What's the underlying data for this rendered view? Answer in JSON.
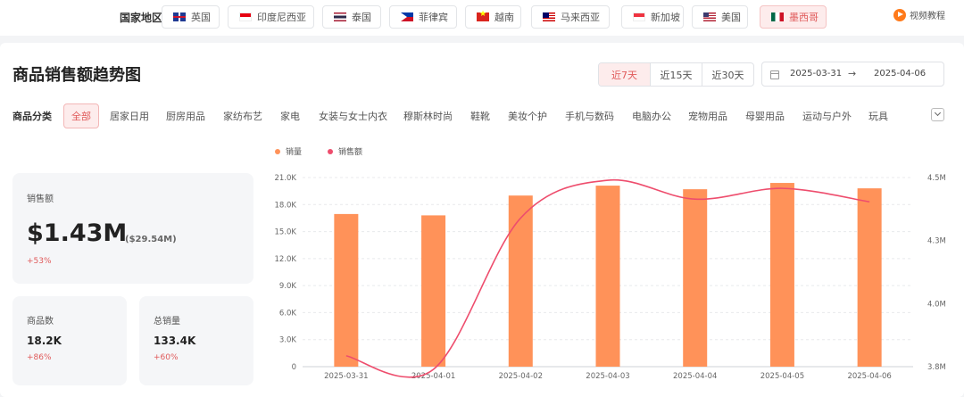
{
  "region": {
    "label": "国家地区",
    "countries": [
      {
        "name": "英国",
        "flag": "uk-flag-icon",
        "active": false
      },
      {
        "name": "印度尼西亚",
        "flag": "indonesia-flag-icon",
        "active": false
      },
      {
        "name": "泰国",
        "flag": "thailand-flag-icon",
        "active": false
      },
      {
        "name": "菲律宾",
        "flag": "philippines-flag-icon",
        "active": false
      },
      {
        "name": "越南",
        "flag": "vietnam-flag-icon",
        "active": false
      },
      {
        "name": "马来西亚",
        "flag": "malaysia-flag-icon",
        "active": false
      },
      {
        "name": "新加坡",
        "flag": "singapore-flag-icon",
        "active": false
      },
      {
        "name": "美国",
        "flag": "usa-flag-icon",
        "active": false
      },
      {
        "name": "墨西哥",
        "flag": "mexico-flag-icon",
        "active": true
      }
    ],
    "video_link": "视频教程"
  },
  "header": {
    "title": "商品销售额趋势图",
    "ranges": [
      {
        "label": "近7天",
        "active": true
      },
      {
        "label": "近15天",
        "active": false
      },
      {
        "label": "近30天",
        "active": false
      }
    ],
    "date_start": "2025-03-31",
    "date_arrow": "→",
    "date_end": "2025-04-06"
  },
  "categories": {
    "label": "商品分类",
    "items": [
      "全部",
      "居家日用",
      "厨房用品",
      "家纺布艺",
      "家电",
      "女装与女士内衣",
      "穆斯林时尚",
      "鞋靴",
      "美妆个护",
      "手机与数码",
      "电脑办公",
      "宠物用品",
      "母婴用品",
      "运动与户外",
      "玩具"
    ],
    "active_index": 0
  },
  "stats": {
    "sales": {
      "label": "销售额",
      "value": "$1.43M",
      "sub": "($29.54M)",
      "change": "+53%"
    },
    "products": {
      "label": "商品数",
      "value": "18.2K",
      "change": "+86%"
    },
    "volume": {
      "label": "总销量",
      "value": "133.4K",
      "change": "+60%"
    }
  },
  "colors": {
    "bar": "#ff9259",
    "line": "#ee4d6d",
    "accent": "#e05a5a",
    "play": "#ff7a1a"
  },
  "chart_data": {
    "type": "bar",
    "categories": [
      "2025-03-31",
      "2025-04-01",
      "2025-04-02",
      "2025-04-03",
      "2025-04-04",
      "2025-04-05",
      "2025-04-06"
    ],
    "series": [
      {
        "name": "销量",
        "type": "bar",
        "axis": "left",
        "values": [
          16950,
          16800,
          19000,
          20100,
          19700,
          20400,
          19800
        ]
      },
      {
        "name": "销售额",
        "type": "line",
        "axis": "right",
        "smooth": true,
        "values": [
          3.84,
          3.79,
          4.35,
          4.49,
          4.42,
          4.46,
          4.41
        ]
      }
    ],
    "y_left": {
      "min": 0,
      "max": 21000,
      "ticks": [
        "0",
        "3.0K",
        "6.0K",
        "9.0K",
        "12.0K",
        "15.0K",
        "18.0K",
        "21.0K"
      ]
    },
    "y_right": {
      "min": 3.8,
      "max": 4.5,
      "ticks": [
        "3.8M",
        "4.0M",
        "4.3M",
        "4.5M"
      ]
    },
    "legend_position": "top-left",
    "grid": true
  }
}
